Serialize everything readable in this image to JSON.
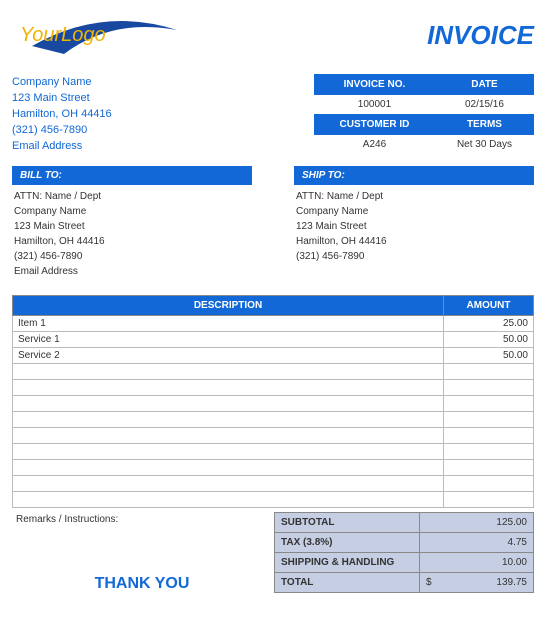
{
  "logo": {
    "part1": "Your",
    "part2": "Logo"
  },
  "title": "INVOICE",
  "company": {
    "name": "Company Name",
    "street": "123 Main Street",
    "city": "Hamilton, OH  44416",
    "phone": "(321) 456-7890",
    "email": "Email Address"
  },
  "meta": {
    "invoice_no_label": "INVOICE NO.",
    "date_label": "DATE",
    "customer_id_label": "CUSTOMER ID",
    "terms_label": "TERMS",
    "invoice_no": "100001",
    "date": "02/15/16",
    "customer_id": "A246",
    "terms": "Net 30 Days"
  },
  "bill_to": {
    "header": "BILL TO:",
    "attn": "ATTN: Name / Dept",
    "company": "Company Name",
    "street": "123 Main Street",
    "city": "Hamilton, OH  44416",
    "phone": "(321) 456-7890",
    "email": "Email Address"
  },
  "ship_to": {
    "header": "SHIP TO:",
    "attn": "ATTN: Name / Dept",
    "company": "Company Name",
    "street": "123 Main Street",
    "city": "Hamilton, OH  44416",
    "phone": "(321) 456-7890"
  },
  "line_headers": {
    "description": "DESCRIPTION",
    "amount": "AMOUNT"
  },
  "lines": [
    {
      "desc": "Item 1",
      "amount": "25.00"
    },
    {
      "desc": "Service 1",
      "amount": "50.00"
    },
    {
      "desc": "Service 2",
      "amount": "50.00"
    },
    {
      "desc": "",
      "amount": ""
    },
    {
      "desc": "",
      "amount": ""
    },
    {
      "desc": "",
      "amount": ""
    },
    {
      "desc": "",
      "amount": ""
    },
    {
      "desc": "",
      "amount": ""
    },
    {
      "desc": "",
      "amount": ""
    },
    {
      "desc": "",
      "amount": ""
    },
    {
      "desc": "",
      "amount": ""
    },
    {
      "desc": "",
      "amount": ""
    }
  ],
  "remarks_label": "Remarks / Instructions:",
  "totals": {
    "subtotal_label": "SUBTOTAL",
    "subtotal": "125.00",
    "tax_label": "TAX (3.8%)",
    "tax": "4.75",
    "shipping_label": "SHIPPING & HANDLING",
    "shipping": "10.00",
    "total_label": "TOTAL",
    "total_currency": "$",
    "total": "139.75"
  },
  "thank_you": "THANK YOU"
}
